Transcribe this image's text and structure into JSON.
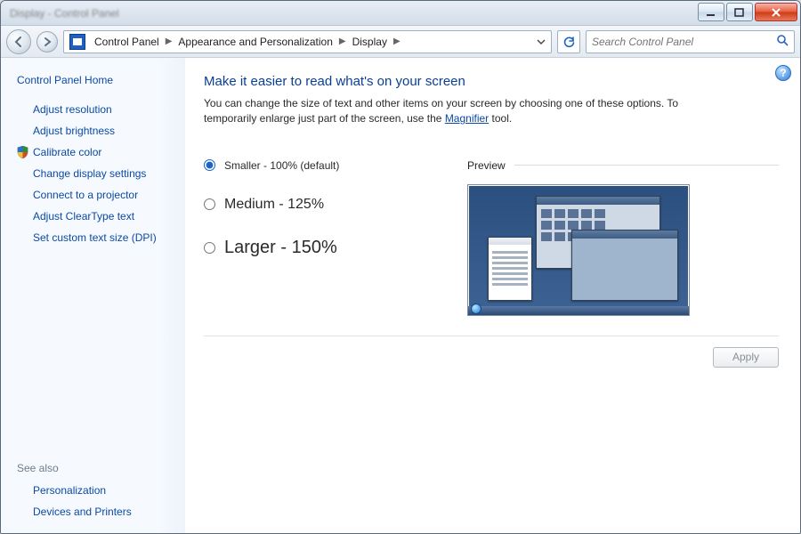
{
  "titlebar": {
    "caption": ""
  },
  "breadcrumb": {
    "items": [
      "Control Panel",
      "Appearance and Personalization",
      "Display"
    ]
  },
  "search": {
    "placeholder": "Search Control Panel"
  },
  "sidebar": {
    "home": "Control Panel Home",
    "links": [
      {
        "label": "Adjust resolution",
        "shield": false
      },
      {
        "label": "Adjust brightness",
        "shield": false
      },
      {
        "label": "Calibrate color",
        "shield": true
      },
      {
        "label": "Change display settings",
        "shield": false
      },
      {
        "label": "Connect to a projector",
        "shield": false
      },
      {
        "label": "Adjust ClearType text",
        "shield": false
      },
      {
        "label": "Set custom text size (DPI)",
        "shield": false
      }
    ],
    "see_also_label": "See also",
    "see_also": [
      {
        "label": "Personalization"
      },
      {
        "label": "Devices and Printers"
      }
    ]
  },
  "main": {
    "title": "Make it easier to read what's on your screen",
    "desc_pre": "You can change the size of text and other items on your screen by choosing one of these options. To temporarily enlarge just part of the screen, use the ",
    "desc_link": "Magnifier",
    "desc_post": " tool.",
    "options": [
      {
        "label": "Smaller - 100% (default)",
        "selected": true
      },
      {
        "label": "Medium - 125%",
        "selected": false
      },
      {
        "label": "Larger - 150%",
        "selected": false
      }
    ],
    "preview_label": "Preview",
    "apply_label": "Apply"
  }
}
